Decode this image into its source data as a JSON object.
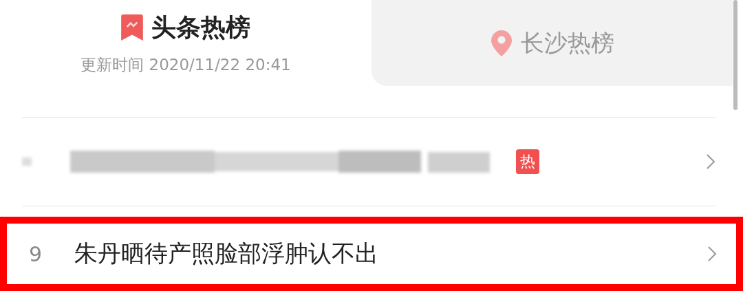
{
  "tabs": [
    {
      "label": "头条热榜",
      "subtitle": "更新时间 2020/11/22 20:41",
      "kind": "ranking",
      "selected": true
    },
    {
      "label": "长沙热榜",
      "kind": "local",
      "selected": false
    }
  ],
  "rows": [
    {
      "kind": "blurred",
      "tag": "热",
      "highlighted": false
    },
    {
      "kind": "text",
      "rank": "9",
      "title": "朱丹晒待产照脸部浮肿认不出",
      "highlighted": true
    }
  ]
}
